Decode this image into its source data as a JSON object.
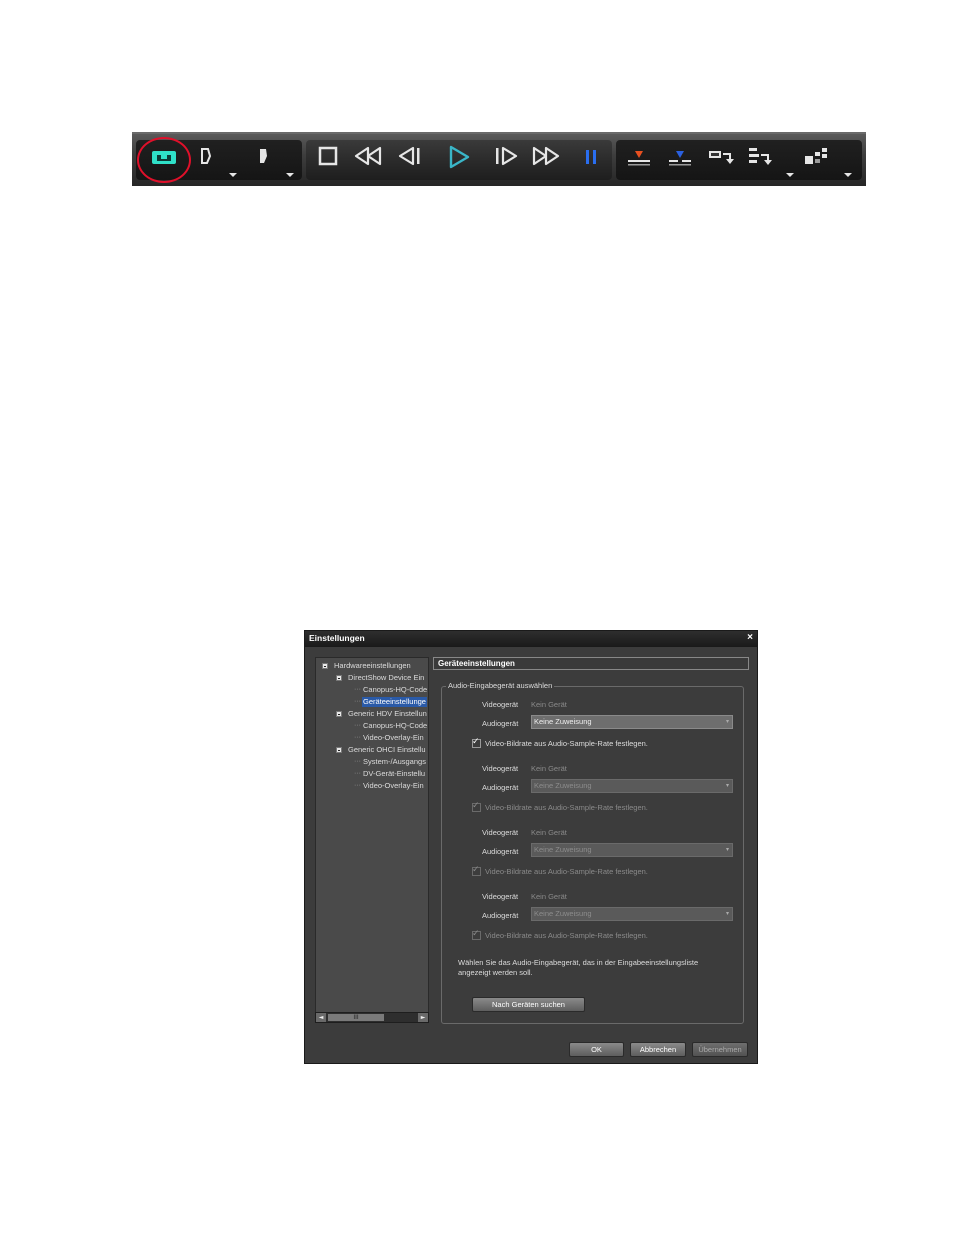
{
  "toolbar": {
    "buttons": [
      {
        "name": "capture-icon"
      },
      {
        "name": "set-in-point-icon"
      },
      {
        "name": "set-out-point-icon"
      },
      {
        "name": "stop-icon"
      },
      {
        "name": "rewind-icon"
      },
      {
        "name": "step-back-icon"
      },
      {
        "name": "play-icon"
      },
      {
        "name": "step-forward-icon"
      },
      {
        "name": "fast-forward-icon"
      },
      {
        "name": "pause-icon"
      },
      {
        "name": "insert-to-timeline-icon"
      },
      {
        "name": "overwrite-to-timeline-icon"
      },
      {
        "name": "export-icon"
      },
      {
        "name": "batch-icon"
      },
      {
        "name": "layout-icon"
      }
    ],
    "colors": {
      "capture": "#2fe0c8",
      "play": "#3ab6c8",
      "pause": "#2a6ef0",
      "insert": "#e85020",
      "overwrite": "#2a60e0",
      "highlight": "#e0102a"
    }
  },
  "dialog": {
    "title": "Einstellungen",
    "close": "×",
    "tree": {
      "items": [
        {
          "label": "Hardwareeinstellungen"
        },
        {
          "label": "DirectShow Device Ein"
        },
        {
          "label": "Canopus-HQ-Code"
        },
        {
          "label": "Geräteeinstellunge"
        },
        {
          "label": "Generic HDV Einstellun"
        },
        {
          "label": "Canopus-HQ-Code"
        },
        {
          "label": "Video-Overlay-Ein"
        },
        {
          "label": "Generic OHCI Einstellu"
        },
        {
          "label": "System-/Ausgangs"
        },
        {
          "label": "DV-Gerät-Einstellu"
        },
        {
          "label": "Video-Overlay-Ein"
        }
      ],
      "scroll_thumb": "III",
      "scroll_left": "◄",
      "scroll_right": "►"
    },
    "panel_title": "Geräteeinstellungen",
    "group_title": "Audio-Eingabegerät auswählen",
    "rows": [
      {
        "video_label": "Videogerät",
        "video_value": "Kein Gerät",
        "audio_label": "Audiogerät",
        "audio_value": "Keine Zuweisung",
        "checkbox": "Video-Bildrate aus Audio-Sample-Rate festlegen."
      },
      {
        "video_label": "Videogerät",
        "video_value": "Kein Gerät",
        "audio_label": "Audiogerät",
        "audio_value": "Keine Zuweisung",
        "checkbox": "Video-Bildrate aus Audio-Sample-Rate festlegen."
      },
      {
        "video_label": "Videogerät",
        "video_value": "Kein Gerät",
        "audio_label": "Audiogerät",
        "audio_value": "Keine Zuweisung",
        "checkbox": "Video-Bildrate aus Audio-Sample-Rate festlegen."
      },
      {
        "video_label": "Videogerät",
        "video_value": "Kein Gerät",
        "audio_label": "Audiogerät",
        "audio_value": "Keine Zuweisung",
        "checkbox": "Video-Bildrate aus Audio-Sample-Rate festlegen."
      }
    ],
    "check_mark": "✓",
    "dropdown_arrow": "▾",
    "info_text_line1": "Wählen Sie das Audio-Eingabegerät, das in der Eingabeeinstellungsliste",
    "info_text_line2": "angezeigt werden soll.",
    "search_button": "Nach Geräten suchen",
    "ok_button": "OK",
    "cancel_button": "Abbrechen",
    "apply_button": "Übernehmen"
  }
}
